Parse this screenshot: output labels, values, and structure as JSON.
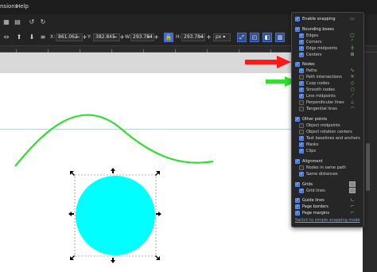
{
  "menubar": {
    "item": "nsions",
    "help": "Help"
  },
  "toolbar": {
    "x_label": "X:",
    "x_value": "861.062",
    "y_label": "Y:",
    "y_value": "382.845",
    "w_label": "W:",
    "w_value": "293.784",
    "h_label": "H:",
    "h_value": "293.784",
    "unit": "px"
  },
  "snap_popup": {
    "enable_snapping": "Enable snapping",
    "bounding_boxes": "Bounding boxes",
    "edges": "Edges",
    "corners": "Corners",
    "edge_midpoints": "Edge midpoints",
    "centers": "Centers",
    "nodes": "Nodes",
    "paths": "Paths",
    "path_intersections": "Path intersections",
    "cusp_nodes": "Cusp nodes",
    "smooth_nodes": "Smooth nodes",
    "line_midpoints": "Line midpoints",
    "perpendicular_lines": "Perpendicular lines",
    "tangential_lines": "Tangential lines",
    "other_points": "Other points",
    "object_midpoints": "Object midpoints",
    "object_rotation_centers": "Object rotation centers",
    "text_baselines": "Text baselines and anchors",
    "masks": "Masks",
    "clips": "Clips",
    "alignment": "Alignment",
    "nodes_same_path": "Nodes in same path",
    "same_distances": "Same distances",
    "grids": "Grids",
    "grid_lines": "Grid lines",
    "guide_lines": "Guide lines",
    "page_borders": "Page borders",
    "page_margins": "Page margins",
    "simple_mode_link": "Switch to simple snapping mode"
  },
  "colors": {
    "circle_fill": "#00ffff",
    "path_stroke": "#33dd33",
    "red_arrow": "#ff1a1a",
    "green_arrow": "#33dd33",
    "checkbox_accent": "#3d6fd6"
  },
  "icons": [
    "menu-icon",
    "cursor-icon",
    "align-icon",
    "x-field",
    "y-field",
    "w-field",
    "lock-icon",
    "h-field",
    "unit-dropdown",
    "snap-icons"
  ]
}
